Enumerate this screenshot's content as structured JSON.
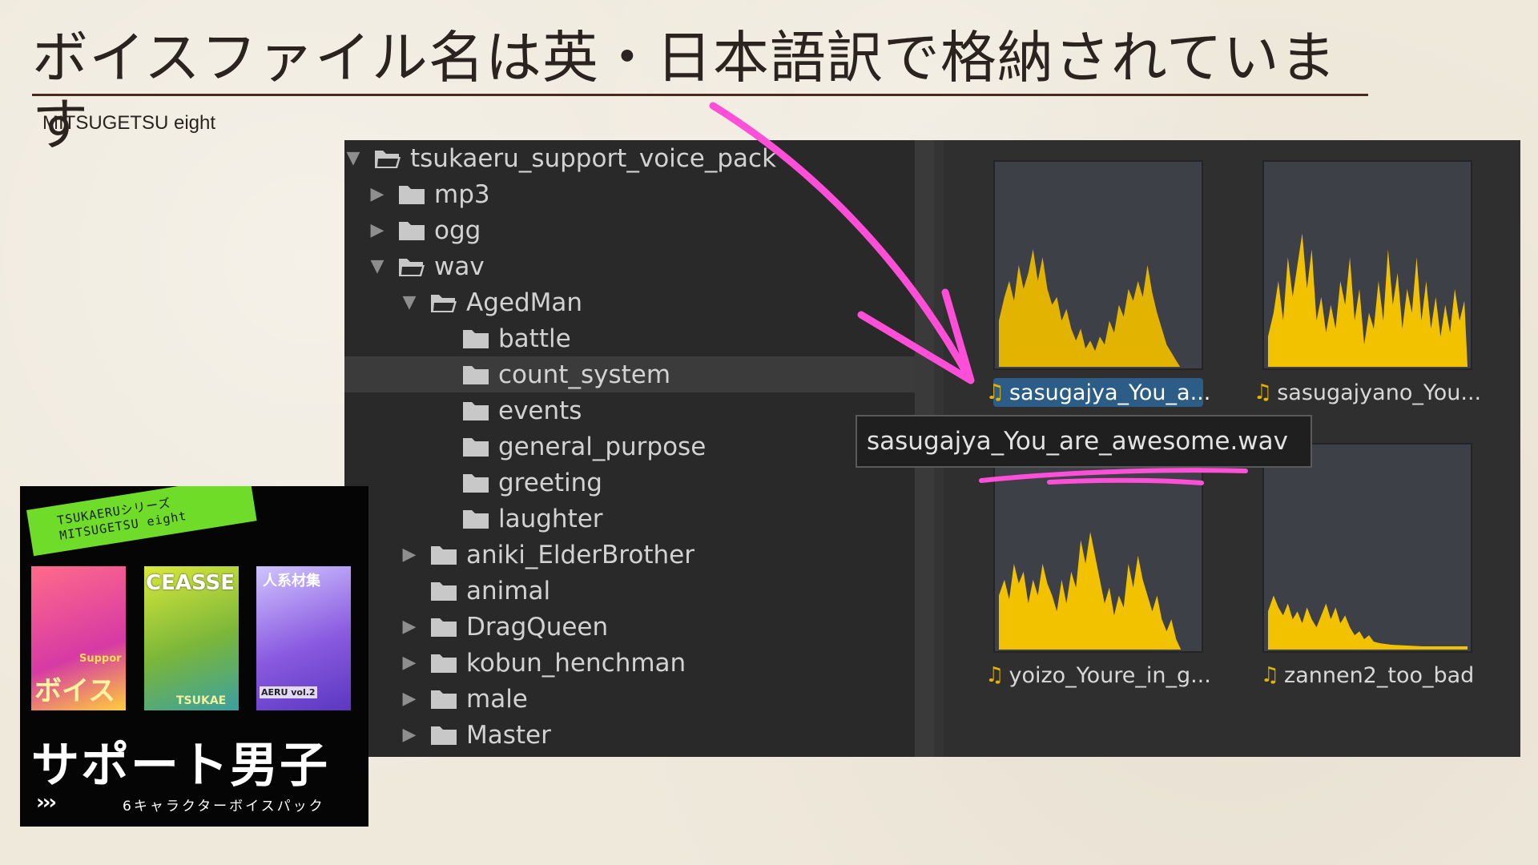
{
  "slide": {
    "title": "ボイスファイル名は英・日本語訳で格納されています",
    "subtitle": "MITSUGETSU eight"
  },
  "tree": {
    "rows": [
      {
        "label": "tsukaeru_support_voice_pack",
        "expanded": true,
        "icon": "folder-open-icon"
      },
      {
        "label": "mp3",
        "expanded": false,
        "icon": "folder-icon"
      },
      {
        "label": "ogg",
        "expanded": false,
        "icon": "folder-icon"
      },
      {
        "label": "wav",
        "expanded": true,
        "icon": "folder-open-icon"
      },
      {
        "label": "AgedMan",
        "expanded": true,
        "icon": "folder-open-icon"
      },
      {
        "label": "battle",
        "icon": "folder-icon"
      },
      {
        "label": "count_system",
        "icon": "folder-icon",
        "selected": true
      },
      {
        "label": "events",
        "icon": "folder-icon"
      },
      {
        "label": "general_purpose",
        "icon": "folder-icon"
      },
      {
        "label": "greeting",
        "icon": "folder-icon"
      },
      {
        "label": "laughter",
        "icon": "folder-icon"
      },
      {
        "label": "aniki_ElderBrother",
        "expanded": false,
        "icon": "folder-icon"
      },
      {
        "label": "animal",
        "icon": "folder-icon"
      },
      {
        "label": "DragQueen",
        "expanded": false,
        "icon": "folder-icon"
      },
      {
        "label": "kobun_henchman",
        "expanded": false,
        "icon": "folder-icon"
      },
      {
        "label": "male",
        "expanded": false,
        "icon": "folder-icon"
      },
      {
        "label": "Master",
        "expanded": false,
        "icon": "folder-icon"
      }
    ]
  },
  "assets": [
    {
      "label": "sasugajya_You_a...",
      "selected": true,
      "icon": "music-note-icon"
    },
    {
      "label": "sasugajyano_You...",
      "selected": false,
      "icon": "music-note-icon"
    },
    {
      "label": "yoizo_Youre_in_g...",
      "selected": false,
      "icon": "music-note-icon"
    },
    {
      "label": "zannen2_too_bad",
      "selected": false,
      "icon": "music-note-icon"
    }
  ],
  "tooltip": {
    "text": "sasugajya_You_are_awesome.wav"
  },
  "cover": {
    "tape_line1": "TSUKAERUシリーズ",
    "tape_line2": "MITSUGETSU eight",
    "book1_text": "ボイス",
    "book1_side": "Suppor",
    "book2_text": "CEASSE",
    "book2_bottom": "TSUKAE",
    "book3_top": "人系材集",
    "book3_side": "AERU vol.2",
    "title": "サポート男子",
    "chevrons": "›››",
    "subtitle": "6キャラクターボイスパック"
  },
  "colors": {
    "accent_pink": "#ff4fd8",
    "waveform": "#f2c200",
    "selection_blue": "#2c5d87",
    "tape_green": "#6fdc29"
  }
}
